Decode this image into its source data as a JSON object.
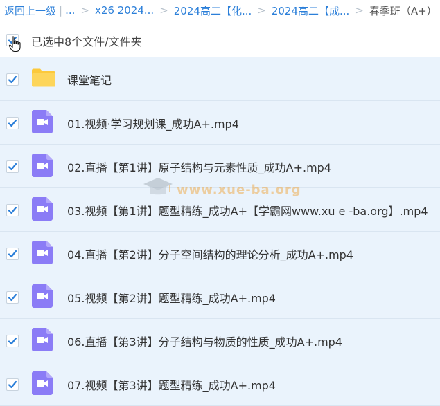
{
  "breadcrumb": {
    "back": "返回上一级",
    "ellipsis": "...",
    "items": [
      "x26 2024...",
      "2024高二【化...",
      "2024高二【成..."
    ],
    "current": "春季班（A+）"
  },
  "selection": {
    "label": "已选中8个文件/文件夹",
    "checked": true
  },
  "files": [
    {
      "name": "课堂笔记",
      "type": "folder",
      "icon": "folder-icon",
      "checked": true
    },
    {
      "name": "01.视频·学习规划课_成功A+.mp4",
      "type": "video",
      "icon": "video-file-icon",
      "checked": true
    },
    {
      "name": "02.直播【第1讲】原子结构与元素性质_成功A+.mp4",
      "type": "video",
      "icon": "video-file-icon",
      "checked": true
    },
    {
      "name": "03.视频【第1讲】题型精练_成功A+【学霸网www.xu e -ba.org】.mp4",
      "type": "video",
      "icon": "video-file-icon",
      "checked": true
    },
    {
      "name": "04.直播【第2讲】分子空间结构的理论分析_成功A+.mp4",
      "type": "video",
      "icon": "video-file-icon",
      "checked": true
    },
    {
      "name": "05.视频【第2讲】题型精练_成功A+.mp4",
      "type": "video",
      "icon": "video-file-icon",
      "checked": true
    },
    {
      "name": "06.直播【第3讲】分子结构与物质的性质_成功A+.mp4",
      "type": "video",
      "icon": "video-file-icon",
      "checked": true
    },
    {
      "name": "07.视频【第3讲】题型精练_成功A+.mp4",
      "type": "video",
      "icon": "video-file-icon",
      "checked": true
    }
  ],
  "watermark": "www.xue-ba.org",
  "colors": {
    "link": "#2b7fd9",
    "row_bg": "#eaf3fc",
    "check": "#2b7fd9",
    "video_icon": "#8b7cf6",
    "folder_icon": "#fcc93b"
  }
}
